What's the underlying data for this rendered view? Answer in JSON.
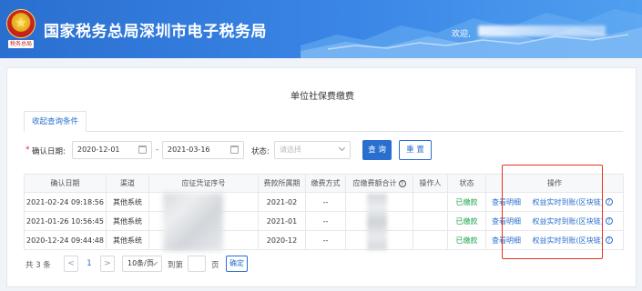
{
  "header": {
    "emblem_tag": "税务总局",
    "title": "国家税务总局深圳市电子税务局",
    "welcome_label": "欢迎,"
  },
  "page_title": "单位社保费缴费",
  "tabs": [
    {
      "label": "收起查询条件"
    }
  ],
  "search": {
    "date_label": "确认日期:",
    "date_from": "2020-12-01",
    "date_to": "2021-03-16",
    "range_sep": "-",
    "status_label": "状态:",
    "status_placeholder": "请选择",
    "query_button": "查 询",
    "reset_button": "重 置"
  },
  "table": {
    "headers": [
      "确认日期",
      "渠道",
      "应征凭证序号",
      "费款所属期",
      "缴费方式",
      "应缴费额合计",
      "操作人",
      "状态",
      "操作"
    ],
    "rows": [
      {
        "date": "2021-02-24 09:18:56",
        "channel": "其他系统",
        "cert": "100",
        "period": "2021-02",
        "method": "--",
        "status": "已缴款",
        "view": "查看明细",
        "rights": "权益实时到账(区块链)"
      },
      {
        "date": "2021-01-26 10:56:45",
        "channel": "其他系统",
        "cert": "100",
        "period": "2021-01",
        "method": "--",
        "status": "已缴款",
        "view": "查看明细",
        "rights": "权益实时到账(区块链)"
      },
      {
        "date": "2020-12-24 09:44:48",
        "channel": "其他系统",
        "cert": "100",
        "period": "2020-12",
        "method": "--",
        "status": "已缴款",
        "view": "查看明细",
        "rights": "权益实时到账(区块链)"
      }
    ]
  },
  "pager": {
    "total": "共 3 条",
    "prev": "<",
    "current_page": "1",
    "next": ">",
    "page_size": "10条/页",
    "goto_label": "到第",
    "page_unit": "页",
    "confirm": "确定"
  },
  "icons": {
    "help": "question-circle-icon",
    "calendar": "calendar-icon",
    "dropdown": "chevron-down-icon"
  },
  "colors": {
    "primary": "#2a6fd0",
    "paid": "#1aa34a",
    "highlight": "#e8321e"
  }
}
